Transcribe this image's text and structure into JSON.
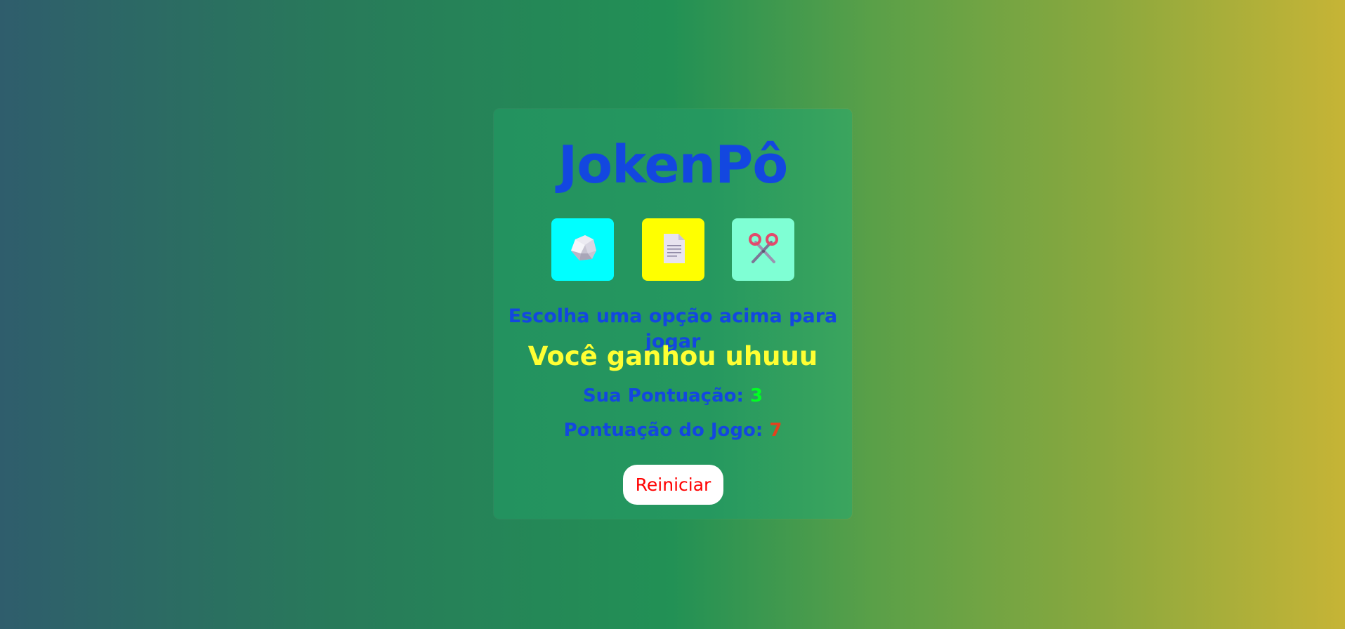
{
  "game": {
    "title": "JokenPô",
    "choices": [
      {
        "id": "rock",
        "icon": "rock-icon",
        "color": "#00ffff"
      },
      {
        "id": "paper",
        "icon": "paper-document-icon",
        "color": "#ffff00"
      },
      {
        "id": "scissors",
        "icon": "scissors-icon",
        "color": "#7fffd4"
      }
    ],
    "instruction": "Escolha uma opção acima para jogar",
    "result": "Você ganhou uhuuu",
    "player_score_label": "Sua Pontuação: ",
    "player_score": "3",
    "computer_score_label": "Pontuação do Jogo: ",
    "computer_score": "7",
    "restart_label": "Reiniciar"
  },
  "colors": {
    "title": "#1347e0",
    "result": "#ffff33",
    "player_score": "#00ff22",
    "computer_score": "#e3421d",
    "restart_text": "#ff0000"
  }
}
